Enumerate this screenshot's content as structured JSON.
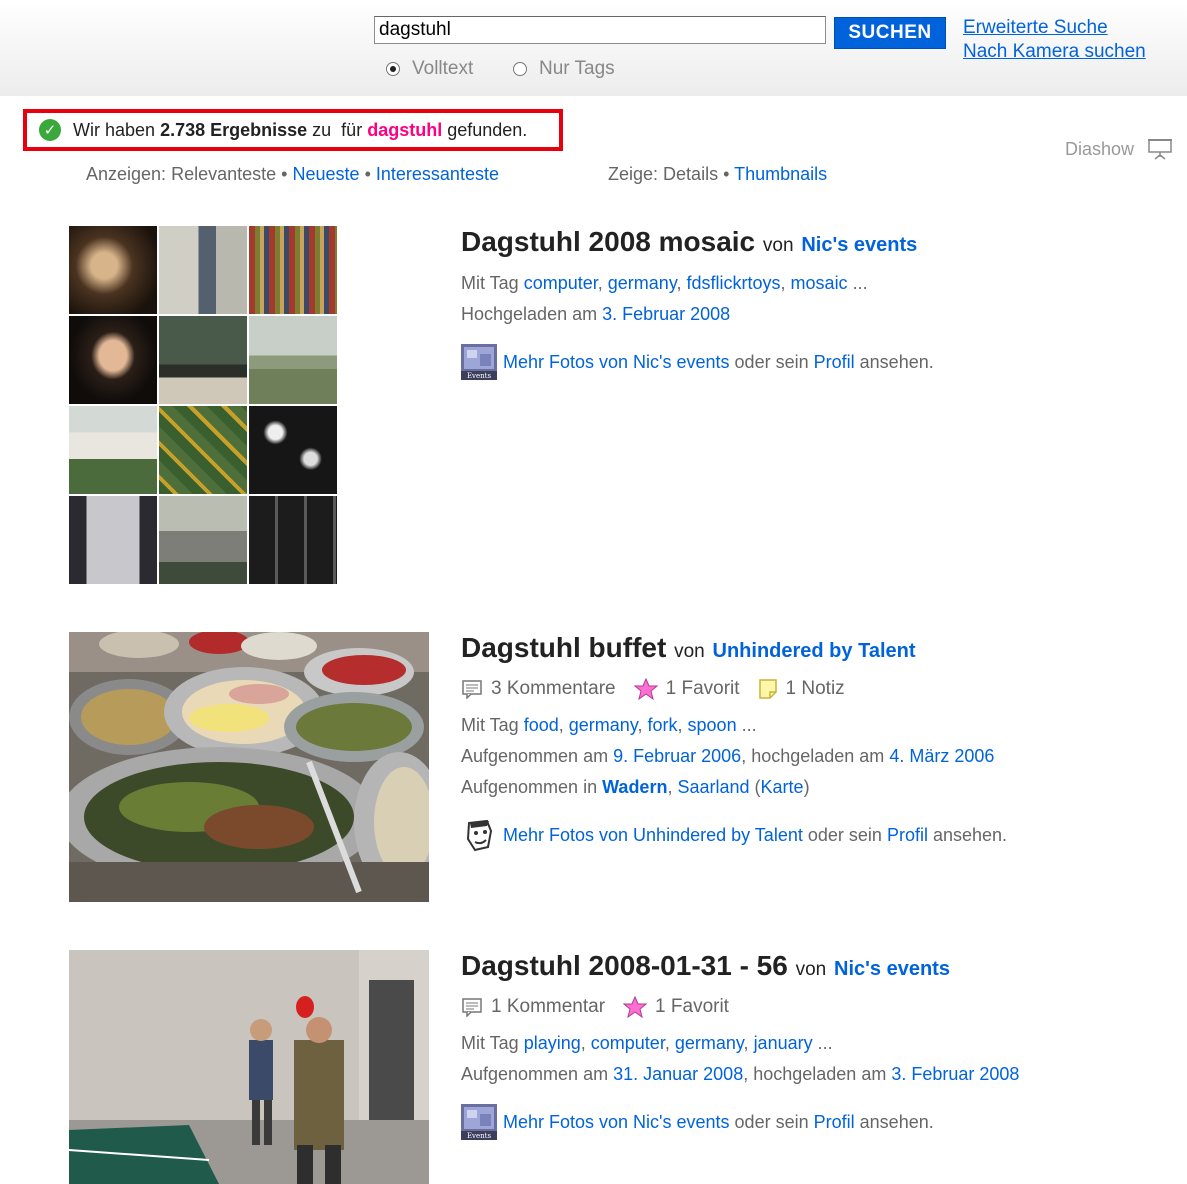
{
  "search": {
    "query": "dagstuhl",
    "button_label": "SUCHEN",
    "advanced_link": "Erweiterte Suche",
    "camera_link": "Nach Kamera suchen",
    "radio_fulltext": "Volltext",
    "radio_tags": "Nur Tags"
  },
  "results_summary": {
    "prefix": "Wir haben",
    "count": "2.738 Ergebnisse",
    "middle": "zu  für",
    "term": "dagstuhl",
    "suffix": "gefunden."
  },
  "sort": {
    "label": "Anzeigen:",
    "relevant": "Relevanteste",
    "newest": "Neueste",
    "interesting": "Interessanteste",
    "separator": "•"
  },
  "view": {
    "label": "Zeige:",
    "details": "Details",
    "thumbnails": "Thumbnails",
    "separator": "•"
  },
  "diashow": {
    "label": "Diashow",
    "icon": "slideshow-icon"
  },
  "results": [
    {
      "title": "Dagstuhl 2008 mosaic",
      "by": "von",
      "owner": "Nic's events",
      "tags_label": "Mit Tag",
      "tags": [
        "computer",
        "germany",
        "fdsflickrtoys",
        "mosaic"
      ],
      "tags_more": "...",
      "uploaded_label": "Hochgeladen am",
      "uploaded": "3. Februar 2008",
      "more_link": "Mehr Fotos von Nic's events",
      "more_or": "oder sein",
      "profile": "Profil",
      "more_suffix": "ansehen.",
      "buddy_icon": "events-buddy-icon"
    },
    {
      "title": "Dagstuhl buffet",
      "by": "von",
      "owner": "Unhindered by Talent",
      "comments": "3 Kommentare",
      "favorites": "1 Favorit",
      "notes": "1 Notiz",
      "tags_label": "Mit Tag",
      "tags": [
        "food",
        "germany",
        "fork",
        "spoon"
      ],
      "tags_more": "...",
      "taken_label": "Aufgenommen am",
      "taken": "9. Februar 2006",
      "uploaded_label": "hochgeladen am",
      "uploaded": "4. März 2006",
      "location_label": "Aufgenommen in",
      "location_city": "Wadern",
      "location_region": "Saarland",
      "map_link": "Karte",
      "more_link": "Mehr Fotos von Unhindered by Talent",
      "more_or": "oder sein",
      "profile": "Profil",
      "more_suffix": "ansehen.",
      "buddy_icon": "cartoon-face-buddy-icon"
    },
    {
      "title": "Dagstuhl 2008-01-31 - 56",
      "by": "von",
      "owner": "Nic's events",
      "comments": "1 Kommentar",
      "favorites": "1 Favorit",
      "tags_label": "Mit Tag",
      "tags": [
        "playing",
        "computer",
        "germany",
        "january"
      ],
      "tags_more": "...",
      "taken_label": "Aufgenommen am",
      "taken": "31. Januar 2008",
      "uploaded_label": "hochgeladen am",
      "uploaded": "3. Februar 2008",
      "more_link": "Mehr Fotos von Nic's events",
      "more_or": "oder sein",
      "profile": "Profil",
      "more_suffix": "ansehen.",
      "buddy_icon": "events-buddy-icon"
    }
  ],
  "colors": {
    "link": "#0063dc",
    "highlight_term": "#ff0084",
    "result_box_border": "#e8000d",
    "search_button": "#0063dc"
  }
}
